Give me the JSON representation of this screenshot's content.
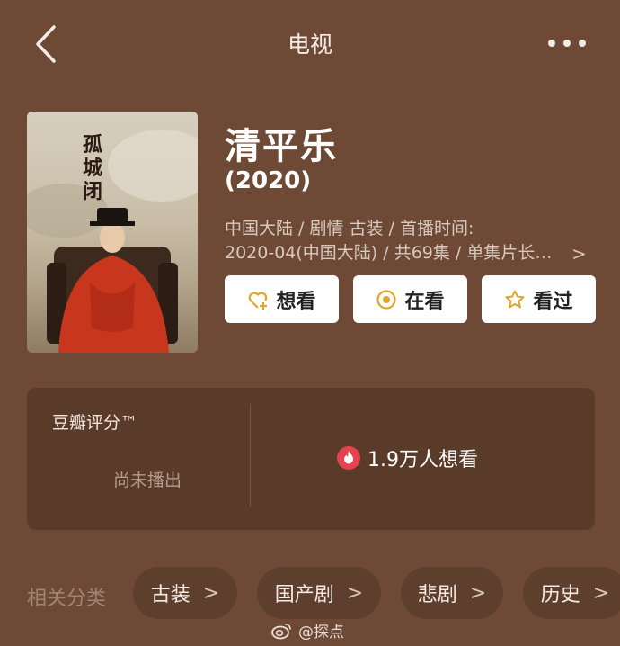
{
  "header": {
    "title": "电视",
    "back_icon": "chevron-left-icon",
    "more_icon": "more-dots-icon"
  },
  "poster": {
    "calligraphy_text": "孤城闭"
  },
  "show": {
    "title": "清平乐",
    "year": "(2020)",
    "meta_line1": "中国大陆 / 剧情 古装 / 首播时间:",
    "meta_line2": "2020-04(中国大陆) / 共69集 / 单集片长…",
    "meta_more": ">"
  },
  "actions": {
    "want": {
      "label": "想看",
      "icon": "heart-plus-icon"
    },
    "watching": {
      "label": "在看",
      "icon": "target-circle-icon"
    },
    "watched": {
      "label": "看过",
      "icon": "star-icon"
    }
  },
  "rating": {
    "label": "豆瓣评分™",
    "status": "尚未播出",
    "want_count": "1.9万人想看",
    "want_icon": "fire-icon"
  },
  "categories": {
    "label": "相关分类",
    "items": [
      "古装",
      "国产剧",
      "悲剧",
      "历史"
    ],
    "chevron": ">"
  },
  "watermark": {
    "text": "@探点",
    "icon": "weibo-icon"
  },
  "colors": {
    "background": "#6e4a36",
    "panel": "#5a3a29",
    "chip": "#5e3e2c",
    "accent_gold": "#e2a52b",
    "fire_red": "#e4434f"
  }
}
